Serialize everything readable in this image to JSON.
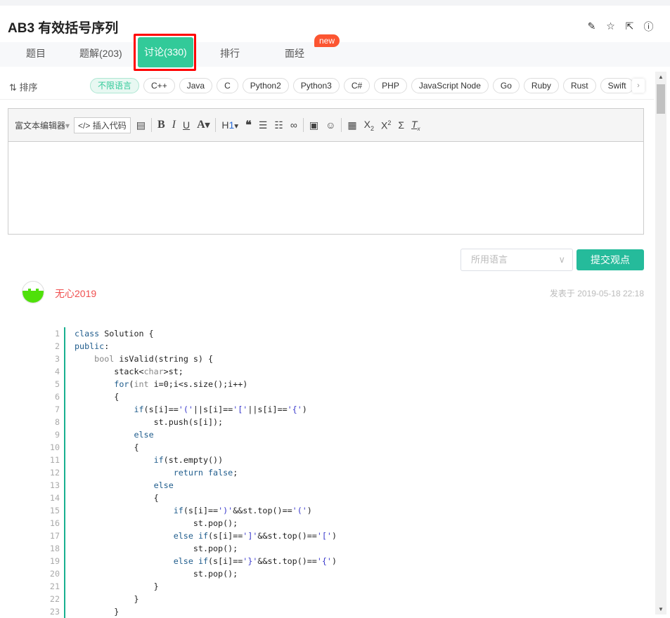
{
  "header": {
    "title": "AB3  有效括号序列",
    "icons": [
      "edit-icon",
      "star-icon",
      "share-icon",
      "info-icon"
    ]
  },
  "tabs": [
    {
      "label": "题目"
    },
    {
      "label": "题解(203)"
    },
    {
      "label": "讨论(330)",
      "active": true
    },
    {
      "label": "排行"
    },
    {
      "label": "面经",
      "badge": "new"
    }
  ],
  "filter": {
    "sort_label": "排序",
    "languages": [
      "不限语言",
      "C++",
      "Java",
      "C",
      "Python2",
      "Python3",
      "C#",
      "PHP",
      "JavaScript Node",
      "Go",
      "Ruby",
      "Rust",
      "Swift"
    ],
    "selected": "不限语言"
  },
  "editor": {
    "mode_label": "富文本编辑器",
    "insert_code_label": "插入代码",
    "content": ""
  },
  "submit": {
    "language_placeholder": "所用语言",
    "button_label": "提交观点"
  },
  "post": {
    "author": "无心2019",
    "time": "发表于 2019-05-18 22:18",
    "code": [
      "class Solution {",
      "public:",
      "    bool isValid(string s) {",
      "        stack<char>st;",
      "        for(int i=0;i<s.size();i++)",
      "        {",
      "            if(s[i]=='('||s[i]=='['||s[i]=='{')",
      "                st.push(s[i]);",
      "            else",
      "            {",
      "                if(st.empty())",
      "                    return false;",
      "                else",
      "                {",
      "                    if(s[i]==')'&&st.top()=='(')",
      "                        st.pop();",
      "                    else if(s[i]==']'&&st.top()=='[')",
      "                        st.pop();",
      "                    else if(s[i]=='}'&&st.top()=='{')",
      "                        st.pop();",
      "                }",
      "            }",
      "        }"
    ]
  },
  "colors": {
    "accent": "#32ca99",
    "submit": "#25bb9b",
    "badge": "#fc5531",
    "highlight_box": "#ff0000",
    "author": "#f04f4f"
  }
}
